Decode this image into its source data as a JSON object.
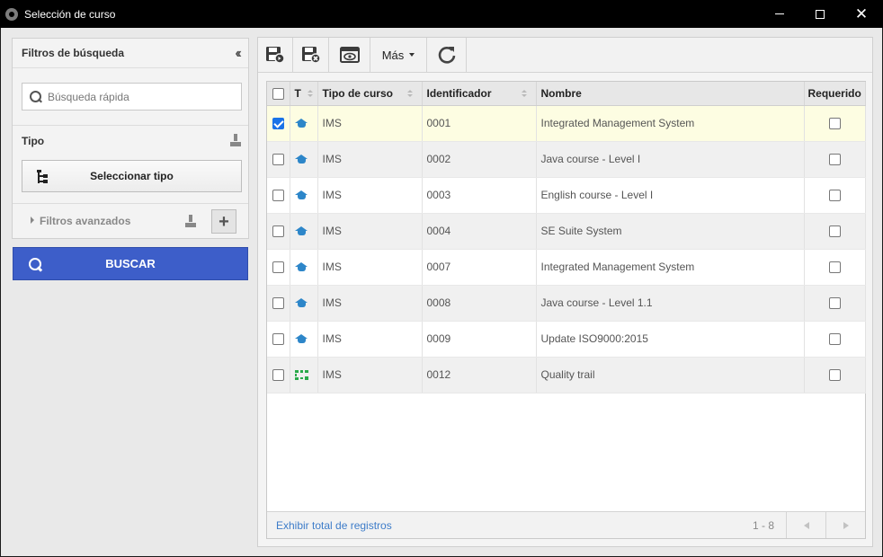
{
  "window": {
    "title": "Selección de curso"
  },
  "filters": {
    "header": "Filtros de búsqueda",
    "search_placeholder": "Búsqueda rápida",
    "tipo_label": "Tipo",
    "select_tipo_label": "Seleccionar tipo",
    "advanced_label": "Filtros avanzados",
    "search_button": "BUSCAR"
  },
  "toolbar": {
    "mas_label": "Más"
  },
  "grid": {
    "columns": [
      "T",
      "Tipo de curso",
      "Identificador",
      "Nombre",
      "Requerido"
    ],
    "rows": [
      {
        "icon": "graduation-cap-icon",
        "tipo": "IMS",
        "id": "0001",
        "nombre": "Integrated Management System",
        "selected": true
      },
      {
        "icon": "graduation-cap-icon",
        "tipo": "IMS",
        "id": "0002",
        "nombre": "Java course - Level I",
        "selected": false
      },
      {
        "icon": "graduation-cap-icon",
        "tipo": "IMS",
        "id": "0003",
        "nombre": "English course - Level I",
        "selected": false
      },
      {
        "icon": "graduation-cap-icon",
        "tipo": "IMS",
        "id": "0004",
        "nombre": "SE Suite System",
        "selected": false
      },
      {
        "icon": "graduation-cap-icon",
        "tipo": "IMS",
        "id": "0007",
        "nombre": "Integrated Management System",
        "selected": false
      },
      {
        "icon": "graduation-cap-icon",
        "tipo": "IMS",
        "id": "0008",
        "nombre": "Java course - Level 1.1",
        "selected": false
      },
      {
        "icon": "graduation-cap-icon",
        "tipo": "IMS",
        "id": "0009",
        "nombre": "Update ISO9000:2015",
        "selected": false
      },
      {
        "icon": "trail-icon",
        "tipo": "IMS",
        "id": "0012",
        "nombre": "Quality trail",
        "selected": false
      }
    ],
    "footer_link": "Exhibir total de registros",
    "pager_count": "1 - 8"
  },
  "colors": {
    "accent": "#3d5ec9",
    "selected_row": "#fdfde2",
    "icon_blue": "#2d86c9",
    "icon_green": "#2aa94b"
  }
}
